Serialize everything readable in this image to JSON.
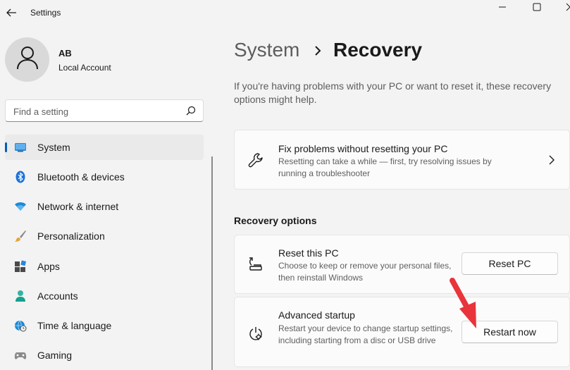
{
  "titlebar": {
    "title": "Settings",
    "back_icon": "arrow-left-icon",
    "controls": [
      "minimize-icon",
      "maximize-icon",
      "close-icon"
    ]
  },
  "account": {
    "initials": "AB",
    "type": "Local Account",
    "avatar_icon": "person-icon"
  },
  "search": {
    "placeholder": "Find a setting",
    "icon": "search-icon"
  },
  "nav": {
    "selected": "System",
    "items": [
      {
        "label": "System",
        "icon": "monitor-icon"
      },
      {
        "label": "Bluetooth & devices",
        "icon": "bluetooth-icon"
      },
      {
        "label": "Network & internet",
        "icon": "wifi-icon"
      },
      {
        "label": "Personalization",
        "icon": "brush-icon"
      },
      {
        "label": "Apps",
        "icon": "apps-icon"
      },
      {
        "label": "Accounts",
        "icon": "person-icon"
      },
      {
        "label": "Time & language",
        "icon": "globe-clock-icon"
      },
      {
        "label": "Gaming",
        "icon": "gamepad-icon"
      }
    ]
  },
  "header": {
    "parent": "System",
    "separator_icon": "chevron-right-icon",
    "current": "Recovery"
  },
  "intro": "If you're having problems with your PC or want to reset it, these recovery options might help.",
  "fix_card": {
    "title": "Fix problems without resetting your PC",
    "description": "Resetting can take a while — first, try resolving issues by running a troubleshooter",
    "icon": "wrench-icon"
  },
  "recovery_options": {
    "section_title": "Recovery options",
    "reset": {
      "title": "Reset this PC",
      "description": "Choose to keep or remove your personal files, then reinstall Windows",
      "button": "Reset PC",
      "icon": "reset-pc-icon"
    },
    "advanced": {
      "title": "Advanced startup",
      "description": "Restart your device to change startup settings, including starting from a disc or USB drive",
      "button": "Restart now",
      "icon": "advanced-startup-icon"
    }
  },
  "colors": {
    "accent": "#005fb8",
    "annotation_arrow": "#e8343a",
    "window_bg": "#f3f3f3",
    "card_bg": "#fbfbfb"
  }
}
